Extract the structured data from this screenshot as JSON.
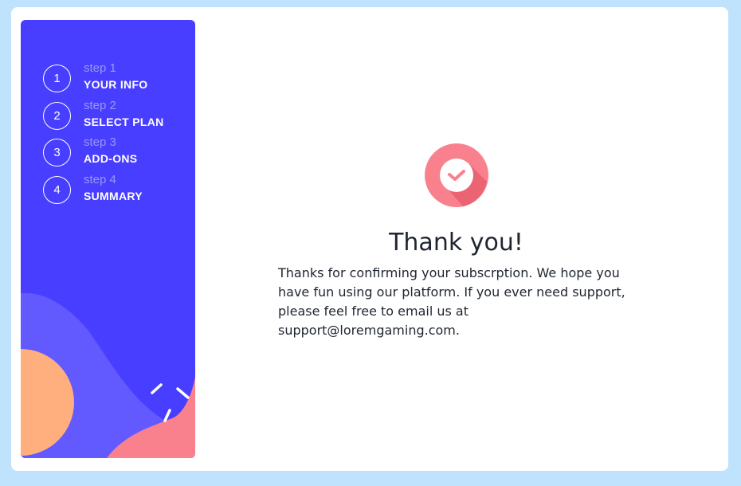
{
  "sidebar": {
    "steps": [
      {
        "number": "1",
        "sub": "step 1",
        "title": "YOUR INFO"
      },
      {
        "number": "2",
        "sub": "step 2",
        "title": "SELECT PLAN"
      },
      {
        "number": "3",
        "sub": "step 3",
        "title": "ADD-ONS"
      },
      {
        "number": "4",
        "sub": "step 4",
        "title": "SUMMARY"
      }
    ]
  },
  "thanks": {
    "title": "Thank you!",
    "text": "Thanks for confirming your subscrption. We hope you have fun using our platform. If you ever need support, please feel free to email us at support@loremgaming.com."
  },
  "colors": {
    "page_bg": "#bfe2fd",
    "sidebar_bg": "#483eff",
    "accent_pink": "#f9818e",
    "accent_orange": "#ffaf7e",
    "text_dark": "#1f2530"
  }
}
